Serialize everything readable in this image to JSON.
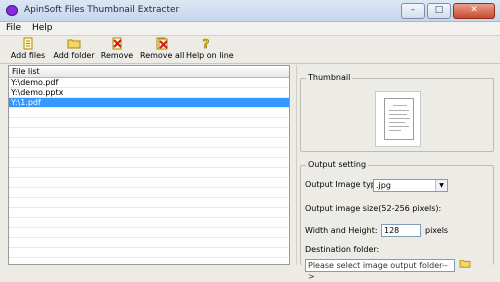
{
  "window": {
    "title": "ApinSoft Files Thumbnail Extracter"
  },
  "menu": {
    "items": [
      {
        "label": "File",
        "underline": "F"
      },
      {
        "label": "Help",
        "underline": "H"
      }
    ]
  },
  "toolbar": {
    "add_files": "Add files",
    "add_folder": "Add folder",
    "remove": "Remove",
    "remove_all": "Remove all",
    "help_online": "Help on line"
  },
  "file_list": {
    "header": "File list",
    "rows": [
      "Y:\\demo.pdf",
      "Y:\\demo.pptx",
      "Y:\\1.pdf"
    ],
    "selected_index": 2
  },
  "thumbnail": {
    "title": "Thumbnail"
  },
  "output": {
    "title": "Output setting",
    "image_type_label": "Output Image type:",
    "image_type_value": ".jpg",
    "size_label": "Output image size(52-256 pixels):",
    "wh_label": "Width and Height:",
    "wh_value": "128",
    "wh_unit": "pixels",
    "dest_label": "Destination folder:",
    "dest_placeholder": "Please select image output folder-->"
  },
  "colors": {
    "selection": "#3399ff",
    "close_button": "#c84a2d"
  }
}
